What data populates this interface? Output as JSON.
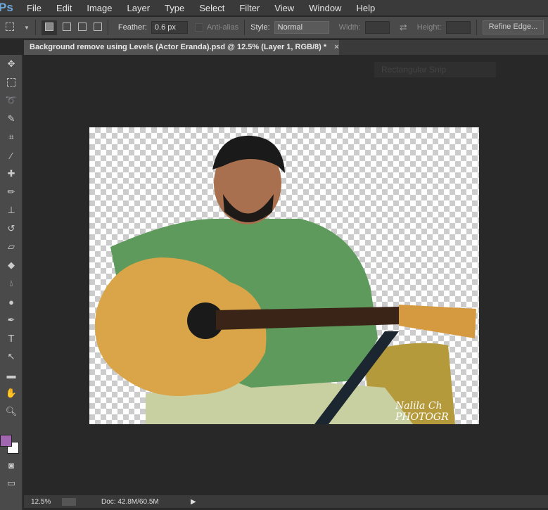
{
  "app": {
    "logo": "Ps"
  },
  "menu": [
    "File",
    "Edit",
    "Image",
    "Layer",
    "Type",
    "Select",
    "Filter",
    "View",
    "Window",
    "Help"
  ],
  "options": {
    "feather_label": "Feather:",
    "feather_value": "0.6 px",
    "antialias_label": "Anti-alias",
    "style_label": "Style:",
    "style_value": "Normal",
    "width_label": "Width:",
    "height_label": "Height:",
    "refine_edge": "Refine Edge..."
  },
  "document": {
    "tab_title": "Background remove using Levels (Actor Eranda).psd @ 12.5% (Layer 1, RGB/8) *",
    "close": "×"
  },
  "overlay": {
    "snip_label": "Rectangular Snip"
  },
  "tools": [
    "move",
    "rectangular-marquee",
    "lasso",
    "quick-selection",
    "crop",
    "eyedropper",
    "healing-brush",
    "brush",
    "clone-stamp",
    "history-brush",
    "eraser",
    "paint-bucket",
    "blur",
    "dodge",
    "pen",
    "type",
    "path-selection",
    "rectangle",
    "hand",
    "zoom"
  ],
  "colors": {
    "foreground": "#a066b0",
    "background": "#ffffff",
    "accent": "#6fa8dc"
  },
  "status": {
    "zoom": "12.5%",
    "doc": "Doc: 42.8M/60.5M"
  },
  "watermark": "Nalila Ch PHOTOGR"
}
